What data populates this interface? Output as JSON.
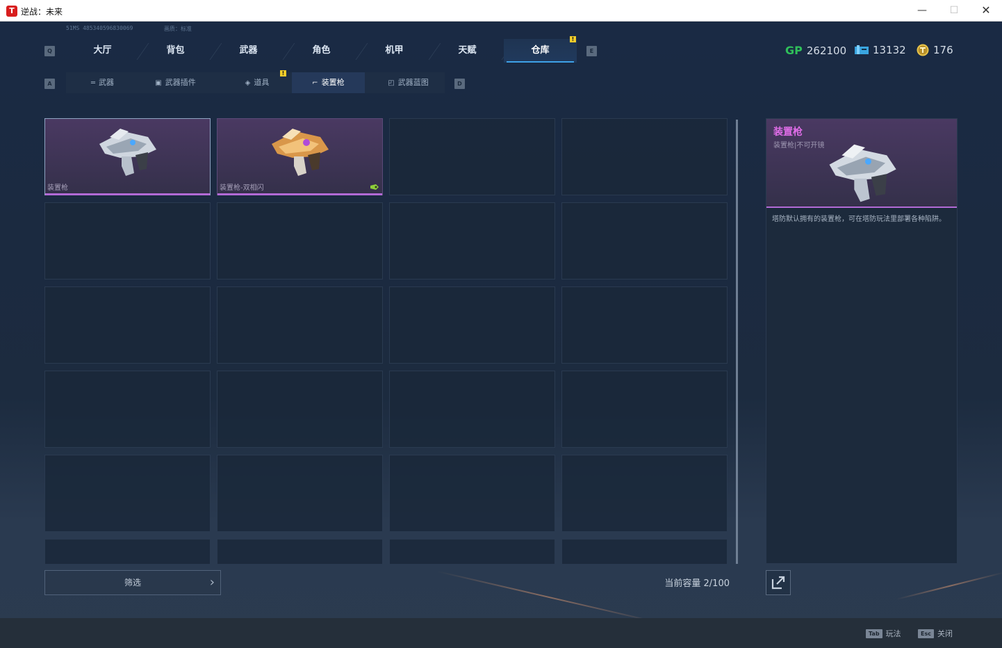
{
  "window": {
    "title": "逆战：未来",
    "app_icon_glyph": "T"
  },
  "sys": {
    "id_text": "51MS 485340596830069",
    "quality_text": "画质：标准"
  },
  "main_tabs": {
    "key_left": "Q",
    "key_right": "E",
    "items": [
      {
        "label": "大厅"
      },
      {
        "label": "背包"
      },
      {
        "label": "武器"
      },
      {
        "label": "角色"
      },
      {
        "label": "机甲"
      },
      {
        "label": "天赋"
      },
      {
        "label": "仓库",
        "active": true
      }
    ],
    "alert_glyph": "!"
  },
  "currencies": [
    {
      "icon": "gp-icon",
      "icon_text": "GP",
      "value": "262100",
      "color": "#2fbf5a"
    },
    {
      "icon": "ticket-icon",
      "value": "13132",
      "color": "#3aa5e0"
    },
    {
      "icon": "coin-icon",
      "value": "176",
      "color": "#e8c44a"
    }
  ],
  "sub_tabs": {
    "key_left": "A",
    "key_right": "D",
    "items": [
      {
        "label": "武器",
        "icon": "rifle-icon"
      },
      {
        "label": "武器插件",
        "icon": "chip-icon"
      },
      {
        "label": "道具",
        "icon": "prop-icon"
      },
      {
        "label": "装置枪",
        "icon": "device-gun-icon",
        "active": true
      },
      {
        "label": "武器蓝图",
        "icon": "blueprint-icon"
      }
    ]
  },
  "inventory": {
    "items": [
      {
        "name": "装置枪",
        "selected": true
      },
      {
        "name": "装置枪-双相闪",
        "selected": false
      }
    ],
    "capacity_label": "当前容量 2/100"
  },
  "filter": {
    "label": "筛选",
    "chevron": "›"
  },
  "detail": {
    "title": "装置枪",
    "subtitle": "装置枪|不可开镜",
    "description": "塔防默认拥有的装置枪，可在塔防玩法里部署各种陷阱。"
  },
  "bottom_hints": [
    {
      "key": "Tab",
      "label": "玩法"
    },
    {
      "key": "Esc",
      "label": "关闭"
    }
  ],
  "colors": {
    "accent": "#3ea1e8",
    "rarity_purple": "#b26ad6",
    "alert": "#f0cc2a"
  }
}
